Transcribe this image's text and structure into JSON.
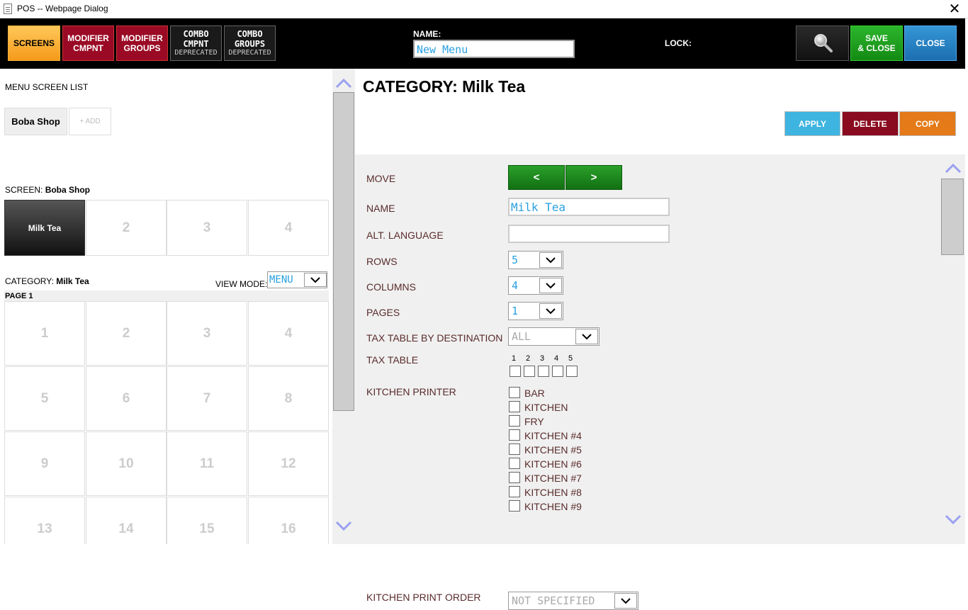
{
  "window": {
    "title": "POS -- Webpage Dialog",
    "close_glyph": "✕"
  },
  "toolbar": {
    "tabs": [
      {
        "label": "SCREENS",
        "sub": ""
      },
      {
        "label": "MODIFIER CMPNT",
        "l1": "MODIFIER",
        "l2": "CMPNT"
      },
      {
        "label": "MODIFIER GROUPS",
        "l1": "MODIFIER",
        "l2": "GROUPS"
      },
      {
        "l1": "COMBO",
        "l2": "CMPNT",
        "sub": "DEPRECATED"
      },
      {
        "l1": "COMBO",
        "l2": "GROUPS",
        "sub": "DEPRECATED"
      }
    ],
    "name_label": "NAME:",
    "name_value": "New Menu",
    "lock_label": "LOCK:",
    "search_icon": "search-icon",
    "save_l1": "SAVE",
    "save_l2": "& CLOSE",
    "close_label": "CLOSE"
  },
  "left": {
    "menu_screen_list_label": "MENU SCREEN LIST",
    "menu_chip": "Boba Shop",
    "add_chip": "+ ADD",
    "screen_prefix": "SCREEN:",
    "screen_name": "Boba Shop",
    "screen_cells": [
      "Milk Tea",
      "2",
      "3",
      "4"
    ],
    "category_prefix": "CATEGORY:",
    "category_name": "Milk Tea",
    "view_mode_label": "VIEW MODE:",
    "view_mode_value": "MENU",
    "page_label": "PAGE 1",
    "grid": [
      "1",
      "2",
      "3",
      "4",
      "5",
      "6",
      "7",
      "8",
      "9",
      "10",
      "11",
      "12",
      "13",
      "14",
      "15",
      "16"
    ]
  },
  "right": {
    "title": "CATEGORY: Milk Tea",
    "apply": "APPLY",
    "delete": "DELETE",
    "copy": "COPY",
    "colors": {
      "apply": "#3eb4e0",
      "delete": "#8a0a20",
      "copy": "#e47a18"
    },
    "form": {
      "move_label": "MOVE",
      "move_prev": "<",
      "move_next": ">",
      "name_label": "NAME",
      "name_value": "Milk Tea",
      "alt_lang_label": "ALT. LANGUAGE",
      "alt_lang_value": "",
      "rows_label": "ROWS",
      "rows_value": "5",
      "columns_label": "COLUMNS",
      "columns_value": "4",
      "pages_label": "PAGES",
      "pages_value": "1",
      "tax_dest_label": "TAX TABLE BY DESTINATION",
      "tax_dest_value": "ALL",
      "tax_table_label": "TAX TABLE",
      "tax_nums": [
        "1",
        "2",
        "3",
        "4",
        "5"
      ],
      "kitchen_printer_label": "KITCHEN PRINTER",
      "printers": [
        "BAR",
        "KITCHEN",
        "FRY",
        "KITCHEN #4",
        "KITCHEN #5",
        "KITCHEN #6",
        "KITCHEN #7",
        "KITCHEN #8",
        "KITCHEN #9"
      ],
      "print_order_label": "KITCHEN PRINT ORDER",
      "print_order_value": "NOT SPECIFIED"
    }
  }
}
